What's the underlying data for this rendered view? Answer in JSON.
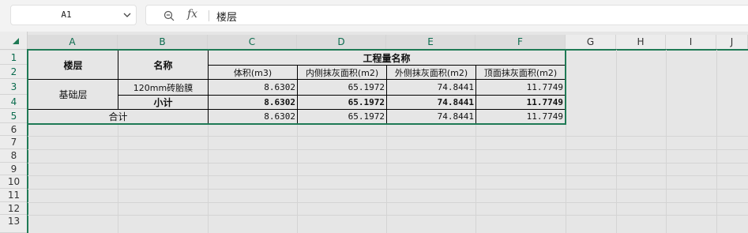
{
  "namebox": {
    "value": "A1"
  },
  "formula": {
    "fx_label": "fx",
    "content": "楼层"
  },
  "columns": [
    "A",
    "B",
    "C",
    "D",
    "E",
    "F",
    "G",
    "H",
    "I",
    "J"
  ],
  "rows": [
    "1",
    "2",
    "3",
    "4",
    "5",
    "6",
    "7",
    "8",
    "9",
    "10",
    "11",
    "12",
    "13"
  ],
  "table": {
    "header_floor": "楼层",
    "header_name": "名称",
    "header_group": "工程量名称",
    "sub_headers": [
      "体积(m3)",
      "内侧抹灰面积(m2)",
      "外侧抹灰面积(m2)",
      "顶面抹灰面积(m2)"
    ],
    "floor_name": "基础层",
    "item_name": "120mm砖胎膜",
    "item_values": [
      "8.6302",
      "65.1972",
      "74.8441",
      "11.7749"
    ],
    "subtotal_label": "小计",
    "subtotal_values": [
      "8.6302",
      "65.1972",
      "74.8441",
      "11.7749"
    ],
    "total_label": "合计",
    "total_values": [
      "8.6302",
      "65.1972",
      "74.8441",
      "11.7749"
    ]
  }
}
